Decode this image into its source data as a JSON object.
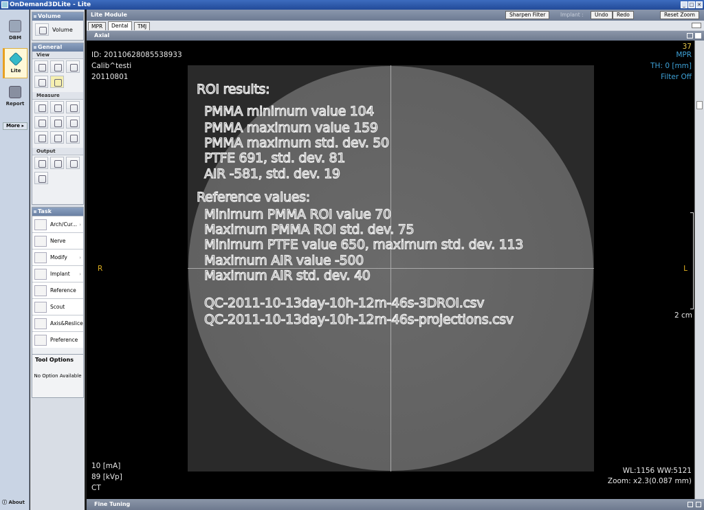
{
  "window": {
    "title": "OnDemand3DLite - Lite",
    "controls": [
      "_",
      "□",
      "✕"
    ]
  },
  "leftnav": {
    "items": [
      {
        "label": "DBM",
        "icon": "database-icon",
        "color": "#9aa6b8"
      },
      {
        "label": "Lite",
        "icon": "cube-icon",
        "color": "#35b9c8"
      },
      {
        "label": "Report",
        "icon": "report-icon",
        "color": "#888fa0"
      }
    ],
    "more": "More",
    "about": "About"
  },
  "toolpanel": {
    "volume_header": "Volume",
    "volume_label": "Volume",
    "general_header": "General",
    "view_header": "View",
    "measure_header": "Measure",
    "output_header": "Output",
    "task_header": "Task",
    "tasks": [
      {
        "label": "Arch/Cur...",
        "arrow": true
      },
      {
        "label": "Nerve",
        "arrow": false
      },
      {
        "label": "Modify",
        "arrow": true
      },
      {
        "label": "Implant",
        "arrow": true
      },
      {
        "label": "Reference",
        "arrow": false
      },
      {
        "label": "Scout",
        "arrow": false
      },
      {
        "label": "Axis&Reslice",
        "arrow": false
      },
      {
        "label": "Preference",
        "arrow": false
      }
    ],
    "tool_options_header": "Tool Options",
    "tool_options_text": "No Option Available"
  },
  "module": {
    "title": "Lite Module",
    "sharpen": "Sharpen Filter",
    "implant_label": "Implant :",
    "undo": "Undo",
    "redo": "Redo",
    "reset_zoom": "Reset Zoom"
  },
  "tabs": [
    {
      "label": "MPR",
      "active": false
    },
    {
      "label": "Dental",
      "active": true
    },
    {
      "label": "TMJ",
      "active": false
    }
  ],
  "view": {
    "title": "Axial",
    "top_left": [
      "ID: 20110628085538933",
      "Calib^testi",
      "20110801"
    ],
    "top_right": {
      "slice": "37",
      "mode": "MPR",
      "th": "TH: 0 [mm]",
      "filter": "Filter Off"
    },
    "left_marker": "R",
    "right_marker": "L",
    "scale": "2 cm",
    "bottom_left": [
      "10 [mA]",
      "89 [kVp]",
      "CT"
    ],
    "bottom_right": [
      "WL:1156 WW:5121",
      "Zoom: x2.3(0.087 mm)"
    ],
    "roi_lines": [
      "ROI results:",
      "PMMA minimum value  104",
      "PMMA maximum value   159",
      "PMMA maximum std. dev.  50",
      "PTFE  691, std. dev.  81",
      "AIR  -581, std. dev.  19",
      "Reference values:",
      "Minimum PMMA ROI value 70",
      "Maximum PMMA ROI std. dev. 75",
      "Minimum PTFE value 650, maximum std. dev. 113",
      "Maximum AIR value -500",
      "Maximum AIR std. dev. 40",
      "QC-2011-10-13day-10h-12m-46s-3DROI.csv",
      "QC-2011-10-13day-10h-12m-46s-projections.csv"
    ]
  },
  "fine_tuning": "Fine Tuning",
  "colors": {
    "accent": "#3ea2d8",
    "slice_number": "#e8c84a",
    "marker": "#e0b020"
  }
}
